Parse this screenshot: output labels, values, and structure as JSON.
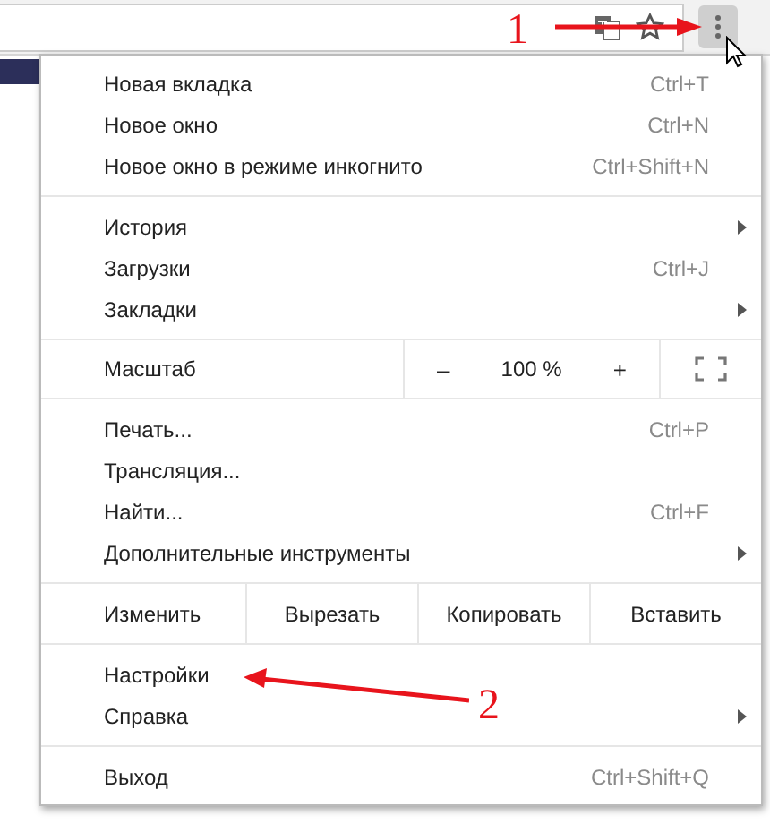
{
  "toolbar": {
    "menu_button": {
      "selected": true
    }
  },
  "menu": {
    "sections": [
      {
        "kind": "items",
        "items": [
          {
            "label": "Новая вкладка",
            "shortcut": "Ctrl+T",
            "submenu": false
          },
          {
            "label": "Новое окно",
            "shortcut": "Ctrl+N",
            "submenu": false
          },
          {
            "label": "Новое окно в режиме инкогнито",
            "shortcut": "Ctrl+Shift+N",
            "submenu": false
          }
        ]
      },
      {
        "kind": "items",
        "items": [
          {
            "label": "История",
            "submenu": true
          },
          {
            "label": "Загрузки",
            "shortcut": "Ctrl+J",
            "submenu": false
          },
          {
            "label": "Закладки",
            "submenu": true
          }
        ]
      },
      {
        "kind": "zoom",
        "label": "Масштаб",
        "minus": "–",
        "value": "100 %",
        "plus": "+"
      },
      {
        "kind": "items",
        "items": [
          {
            "label": "Печать...",
            "shortcut": "Ctrl+P",
            "submenu": false
          },
          {
            "label": "Трансляция...",
            "submenu": false
          },
          {
            "label": "Найти...",
            "shortcut": "Ctrl+F",
            "submenu": false
          },
          {
            "label": "Дополнительные инструменты",
            "submenu": true
          }
        ]
      },
      {
        "kind": "edit",
        "label": "Изменить",
        "buttons": [
          "Вырезать",
          "Копировать",
          "Вставить"
        ]
      },
      {
        "kind": "items",
        "items": [
          {
            "label": "Настройки",
            "submenu": false
          },
          {
            "label": "Справка",
            "submenu": true
          }
        ]
      },
      {
        "kind": "items",
        "items": [
          {
            "label": "Выход",
            "shortcut": "Ctrl+Shift+Q",
            "submenu": false
          }
        ]
      }
    ]
  },
  "annotations": [
    {
      "text": "1"
    },
    {
      "text": "2"
    }
  ]
}
